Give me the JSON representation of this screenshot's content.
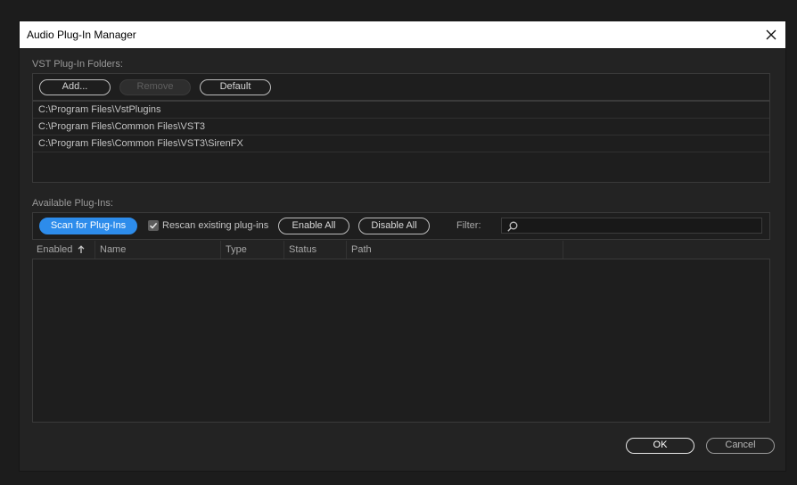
{
  "dialog": {
    "title": "Audio Plug-In Manager"
  },
  "vst_folders": {
    "section_label": "VST Plug-In Folders:",
    "buttons": {
      "add": "Add...",
      "remove": "Remove",
      "default": "Default"
    },
    "folders": [
      "C:\\Program Files\\VstPlugins",
      "C:\\Program Files\\Common Files\\VST3",
      "C:\\Program Files\\Common Files\\VST3\\SirenFX"
    ]
  },
  "available_plugins": {
    "section_label": "Available Plug-Ins:",
    "scan_label": "Scan for Plug-Ins",
    "rescan_label": "Rescan existing plug-ins",
    "rescan_checked": true,
    "enable_all_label": "Enable All",
    "disable_all_label": "Disable All",
    "filter_label": "Filter:",
    "filter_value": "",
    "columns": [
      "Enabled",
      "Name",
      "Type",
      "Status",
      "Path"
    ],
    "sort_column": "Enabled",
    "sort_direction": "ascending",
    "rows": []
  },
  "footer": {
    "ok_label": "OK",
    "cancel_label": "Cancel"
  },
  "colors": {
    "accent": "#2d8ceb",
    "dialog_bg": "#232323",
    "panel_bg": "#1e1e1e"
  },
  "icons": {
    "close": "close-icon",
    "search": "search-icon",
    "check": "checkmark-icon",
    "sort": "arrow-up-icon"
  }
}
